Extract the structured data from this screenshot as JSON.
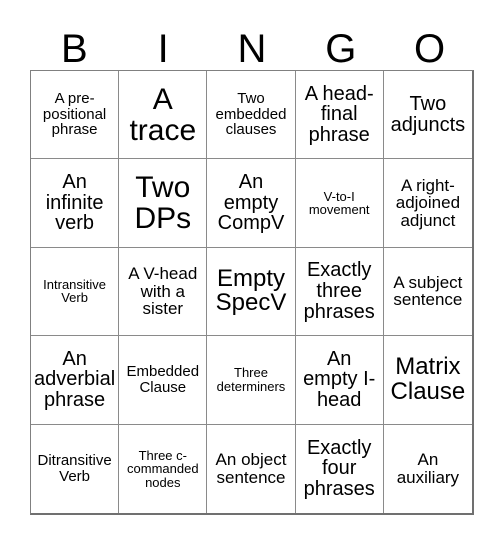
{
  "header": {
    "letters": [
      "B",
      "I",
      "N",
      "G",
      "O"
    ]
  },
  "grid": {
    "rows": 5,
    "columns": 5,
    "border_color": "#8a8a8a",
    "background_color": "#ffffff",
    "text_color": "#000000"
  },
  "cells": [
    {
      "text": "A pre-positional phrase",
      "size": "s"
    },
    {
      "text": "A trace",
      "size": "xxl"
    },
    {
      "text": "Two embedded clauses",
      "size": "s"
    },
    {
      "text": "A head-final phrase",
      "size": "l"
    },
    {
      "text": "Two adjuncts",
      "size": "l"
    },
    {
      "text": "An infinite verb",
      "size": "l"
    },
    {
      "text": "Two DPs",
      "size": "xxl"
    },
    {
      "text": "An empty CompV",
      "size": "l"
    },
    {
      "text": "V-to-I movement",
      "size": "xs"
    },
    {
      "text": "A right-adjoined adjunct",
      "size": "m"
    },
    {
      "text": "Intransitive Verb",
      "size": "xs"
    },
    {
      "text": "A V-head with a sister",
      "size": "m"
    },
    {
      "text": "Empty SpecV",
      "size": "xl"
    },
    {
      "text": "Exactly three phrases",
      "size": "l"
    },
    {
      "text": "A subject sentence",
      "size": "m"
    },
    {
      "text": "An adverbial phrase",
      "size": "l"
    },
    {
      "text": "Embedded Clause",
      "size": "s"
    },
    {
      "text": "Three determiners",
      "size": "xs"
    },
    {
      "text": "An empty I-head",
      "size": "l"
    },
    {
      "text": "Matrix Clause",
      "size": "xl"
    },
    {
      "text": "Ditransitive Verb",
      "size": "s"
    },
    {
      "text": "Three c-commanded nodes",
      "size": "xs"
    },
    {
      "text": "An object sentence",
      "size": "m"
    },
    {
      "text": "Exactly four phrases",
      "size": "l"
    },
    {
      "text": "An auxiliary",
      "size": "m"
    }
  ]
}
